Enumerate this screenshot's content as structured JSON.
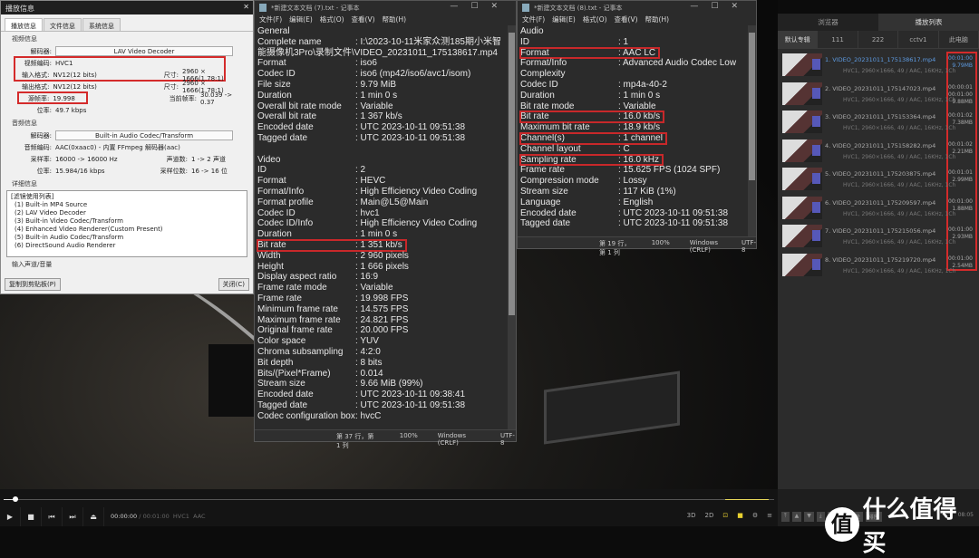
{
  "dialog": {
    "title": "播放信息",
    "close": "✕",
    "tabs": [
      "播放信息",
      "文件信息",
      "系统信息"
    ],
    "video": {
      "group": "视频信息",
      "decoder_label": "解码器:",
      "decoder": "LAV Video Decoder",
      "codec_label": "视频编码:",
      "codec": "HVC1",
      "in_fmt_label": "输入格式:",
      "in_fmt": "NV12(12 bits)",
      "size_label": "尺寸:",
      "in_size": "2960 × 1666(1.78:1)",
      "out_fmt_label": "输出格式:",
      "out_fmt": "NV12(12 bits)",
      "out_size": "2960 × 1666(1.78:1)",
      "src_fps_label": "源帧率:",
      "src_fps": "19.998",
      "cur_fps_label": "当前帧率:",
      "cur_fps": "30.039 -> 0.37",
      "bitrate_label": "位率:",
      "bitrate": "49.7 kbps"
    },
    "audio": {
      "group": "音频信息",
      "decoder_label": "解码器:",
      "decoder": "Built-in Audio Codec/Transform",
      "codec_label": "音频编码:",
      "codec": "AAC(0xaac0) - 内置 FFmpeg 解码器(aac)",
      "rate_label": "采样率:",
      "rate": "16000 -> 16000 Hz",
      "ch_label": "声道数:",
      "ch": "1 -> 2 声道",
      "bitrate_label": "位率:",
      "bitrate": "15.984/16 kbps",
      "bits_label": "采样位数:",
      "bits": "16 -> 16 位"
    },
    "detail": {
      "group": "详细信息",
      "lines": [
        "[滤镜使用列表]",
        "(1) Built-in MP4 Source",
        "(2) LAV Video Decoder",
        "(3) Built-in Video Codec/Transform",
        "(4) Enhanced Video Renderer(Custom Present)",
        "(5) Built-in Audio Codec/Transform",
        "(6) DirectSound Audio Renderer"
      ]
    },
    "input_group": "输入声道/音量",
    "copy_btn": "复制到剪贴板(P)",
    "close_btn": "关闭(C)"
  },
  "notepad1": {
    "title": "*新建文本文档 (7).txt - 记事本",
    "menu": [
      "文件(F)",
      "编辑(E)",
      "格式(O)",
      "查看(V)",
      "帮助(H)"
    ],
    "lines": [
      {
        "k": "General",
        "v": ""
      },
      {
        "k": "Complete name",
        "v": ": I:\\2023-10-11米家众测185期小米智"
      },
      {
        "k": "",
        "v": "能摄像机3Pro\\录制文件\\VIDEO_20231011_175138617.mp4",
        "full": true
      },
      {
        "k": "Format",
        "v": ": iso6"
      },
      {
        "k": "Codec ID",
        "v": ": iso6 (mp42/iso6/avc1/isom)"
      },
      {
        "k": "File size",
        "v": ": 9.79 MiB"
      },
      {
        "k": "Duration",
        "v": ": 1 min 0 s"
      },
      {
        "k": "Overall bit rate mode",
        "v": ": Variable"
      },
      {
        "k": "Overall bit rate",
        "v": ": 1 367 kb/s"
      },
      {
        "k": "Encoded date",
        "v": ": UTC 2023-10-11 09:51:38"
      },
      {
        "k": "Tagged date",
        "v": ": UTC 2023-10-11 09:51:38"
      },
      {
        "k": "",
        "v": ""
      },
      {
        "k": "Video",
        "v": ""
      },
      {
        "k": "ID",
        "v": ": 2"
      },
      {
        "k": "Format",
        "v": ": HEVC"
      },
      {
        "k": "Format/Info",
        "v": ": High Efficiency Video Coding"
      },
      {
        "k": "Format profile",
        "v": ": Main@L5@Main"
      },
      {
        "k": "Codec ID",
        "v": ": hvc1"
      },
      {
        "k": "Codec ID/Info",
        "v": ": High Efficiency Video Coding"
      },
      {
        "k": "Duration",
        "v": ": 1 min 0 s"
      },
      {
        "k": "Bit rate",
        "v": ": 1 351 kb/s",
        "hl": true
      },
      {
        "k": "Width",
        "v": ": 2 960 pixels"
      },
      {
        "k": "Height",
        "v": ": 1 666 pixels"
      },
      {
        "k": "Display aspect ratio",
        "v": ": 16:9"
      },
      {
        "k": "Frame rate mode",
        "v": ": Variable"
      },
      {
        "k": "Frame rate",
        "v": ": 19.998 FPS"
      },
      {
        "k": "Minimum frame rate",
        "v": ": 14.575 FPS"
      },
      {
        "k": "Maximum frame rate",
        "v": ": 24.821 FPS"
      },
      {
        "k": "Original frame rate",
        "v": ": 20.000 FPS"
      },
      {
        "k": "Color space",
        "v": ": YUV"
      },
      {
        "k": "Chroma subsampling",
        "v": ": 4:2:0"
      },
      {
        "k": "Bit depth",
        "v": ": 8 bits"
      },
      {
        "k": "Bits/(Pixel*Frame)",
        "v": ": 0.014"
      },
      {
        "k": "Stream size",
        "v": ": 9.66 MiB (99%)"
      },
      {
        "k": "Encoded date",
        "v": ": UTC 2023-10-11 09:38:41"
      },
      {
        "k": "Tagged date",
        "v": ": UTC 2023-10-11 09:51:38"
      },
      {
        "k": "Codec configuration box",
        "v": ": hvcC"
      }
    ],
    "status": [
      "第 37 行，第 1 列",
      "100%",
      "Windows (CRLF)",
      "UTF-8"
    ]
  },
  "notepad2": {
    "title": "*新建文本文档 (8).txt - 记事本",
    "menu": [
      "文件(F)",
      "编辑(E)",
      "格式(O)",
      "查看(V)",
      "帮助(H)"
    ],
    "lines": [
      {
        "k": "Audio",
        "v": ""
      },
      {
        "k": "ID",
        "v": ": 1"
      },
      {
        "k": "Format",
        "v": ": AAC LC",
        "hl": true
      },
      {
        "k": "Format/Info",
        "v": ": Advanced Audio Codec Low"
      },
      {
        "k": "Complexity",
        "v": ""
      },
      {
        "k": "Codec ID",
        "v": ": mp4a-40-2"
      },
      {
        "k": "Duration",
        "v": ": 1 min 0 s"
      },
      {
        "k": "Bit rate mode",
        "v": ": Variable"
      },
      {
        "k": "Bit rate",
        "v": ": 16.0 kb/s",
        "hl": true
      },
      {
        "k": "Maximum bit rate",
        "v": ": 18.9 kb/s"
      },
      {
        "k": "Channel(s)",
        "v": ": 1 channel",
        "hl": true
      },
      {
        "k": "Channel layout",
        "v": ": C"
      },
      {
        "k": "Sampling rate",
        "v": ": 16.0 kHz",
        "hl": true
      },
      {
        "k": "Frame rate",
        "v": ": 15.625 FPS (1024 SPF)"
      },
      {
        "k": "Compression mode",
        "v": ": Lossy"
      },
      {
        "k": "Stream size",
        "v": ": 117 KiB (1%)"
      },
      {
        "k": "Language",
        "v": ": English"
      },
      {
        "k": "Encoded date",
        "v": ": UTC 2023-10-11 09:51:38"
      },
      {
        "k": "Tagged date",
        "v": ": UTC 2023-10-11 09:51:38"
      }
    ],
    "status": [
      "第 19 行，第 1 列",
      "100%",
      "Windows (CRLF)",
      "UTF-8"
    ]
  },
  "playlist": {
    "tabs": [
      "浏览器",
      "播放列表"
    ],
    "categories": [
      "默认专辑",
      "111",
      "222",
      "cctv1",
      "此电脑"
    ],
    "items": [
      {
        "name": "1. VIDEO_20231011_175138617.mp4",
        "meta": "HVC1, 2960×1666, 49 / AAC, 16KHz, 1Ch",
        "dur": "00:01:00",
        "size": "9.79MB",
        "active": true
      },
      {
        "name": "2. VIDEO_20231011_175147023.mp4",
        "meta": "HVC1, 2960×1666, 49 / AAC, 16KHz, 1Ch",
        "dur": "00:00:01",
        "dur2": "00:01:00",
        "size": "9.88MB"
      },
      {
        "name": "3. VIDEO_20231011_175153364.mp4",
        "meta": "HVC1, 2960×1666, 49 / AAC, 16KHz, 1Ch",
        "dur": "00:01:02",
        "size": "7.38MB"
      },
      {
        "name": "4. VIDEO_20231011_175158282.mp4",
        "meta": "HVC1, 2960×1666, 49 / AAC, 16KHz, 1Ch",
        "dur": "00:01:02",
        "size": "2.21MB"
      },
      {
        "name": "5. VIDEO_20231011_175203875.mp4",
        "meta": "HVC1, 2960×1666, 49 / AAC, 16KHz, 1Ch",
        "dur": "00:01:01",
        "size": "2.99MB"
      },
      {
        "name": "6. VIDEO_20231011_175209597.mp4",
        "meta": "HVC1, 2960×1666, 49 / AAC, 16KHz, 1Ch",
        "dur": "00:01:00",
        "size": "1.88MB"
      },
      {
        "name": "7. VIDEO_20231011_175215056.mp4",
        "meta": "HVC1, 2960×1666, 49 / AAC, 16KHz, 1Ch",
        "dur": "00:01:00",
        "size": "2.93MB"
      },
      {
        "name": "8. VIDEO_20231011_175219720.mp4",
        "meta": "HVC1, 2960×1666, 49 / AAC, 16KHz, 1Ch",
        "dur": "00:01:00",
        "size": "2.54MB"
      }
    ],
    "buttons": [
      "添加",
      "删除",
      "排序"
    ],
    "clock": "08:05"
  },
  "player": {
    "current": "00:00:00",
    "sep": "/",
    "total": "00:01:00",
    "vcodec": "HVC1",
    "acodec": "AAC",
    "progress_percent": 0,
    "volume_percent": 100,
    "right": [
      "3D",
      "2D"
    ]
  },
  "watermark": {
    "icon": "值",
    "text": "什么值得买"
  },
  "colors": {
    "highlight": "#d42b2b",
    "playlist_active": "#5d9ae0",
    "accent": "#e8d030"
  }
}
